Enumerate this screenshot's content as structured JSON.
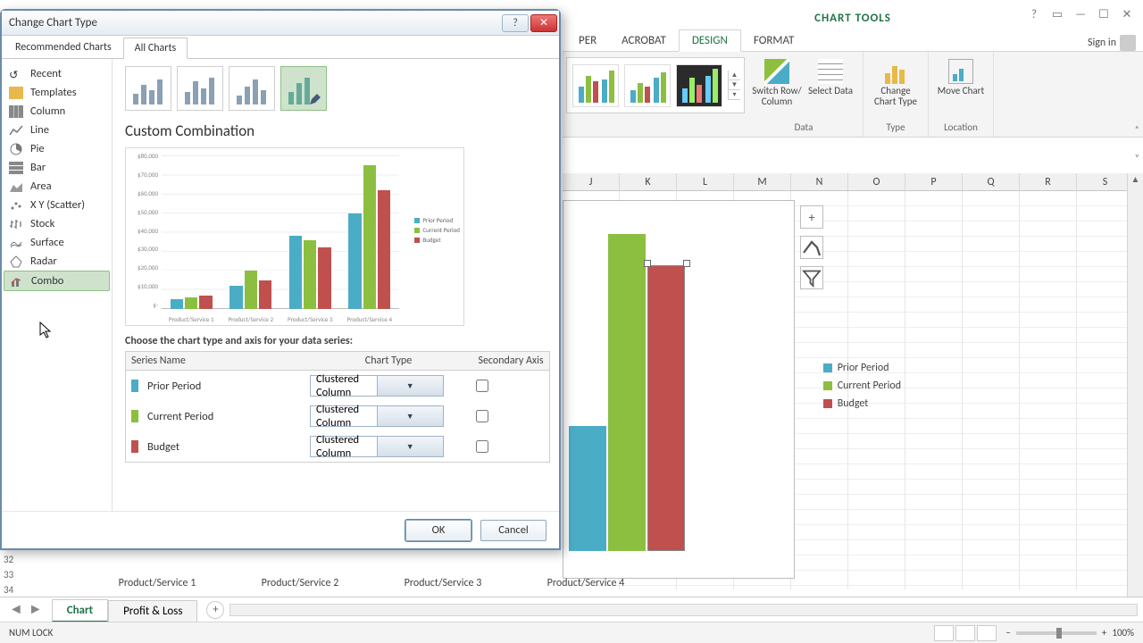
{
  "colors": {
    "prior": "#4bacc6",
    "current": "#8cbf3f",
    "budget": "#c0504d"
  },
  "window": {
    "chart_tools": "CHART TOOLS",
    "tabs": [
      "PER",
      "ACROBAT",
      "DESIGN",
      "FORMAT"
    ],
    "active_tab": "DESIGN",
    "sign_in": "Sign in"
  },
  "ribbon": {
    "groups": {
      "data": {
        "label": "Data",
        "switch": "Switch Row/\nColumn",
        "select": "Select\nData"
      },
      "type": {
        "label": "Type",
        "change": "Change\nChart Type"
      },
      "location": {
        "label": "Location",
        "move": "Move\nChart"
      }
    }
  },
  "columns": [
    "J",
    "K",
    "L",
    "M",
    "N",
    "O",
    "P",
    "Q",
    "R",
    "S"
  ],
  "rows": [
    "32",
    "33",
    "34"
  ],
  "embedded_chart": {
    "legend": [
      "Prior Period",
      "Current Period",
      "Budget"
    ],
    "axis": [
      "Product/Service 1",
      "Product/Service 2",
      "Product/Service 3",
      "Product/Service 4"
    ]
  },
  "sheet_tabs": {
    "active": "Chart",
    "other": "Profit & Loss"
  },
  "status": {
    "numlock": "NUM LOCK",
    "zoom": "100%"
  },
  "dialog": {
    "title": "Change Chart Type",
    "tabs": {
      "recommended": "Recommended Charts",
      "all": "All Charts"
    },
    "categories": [
      "Recent",
      "Templates",
      "Column",
      "Line",
      "Pie",
      "Bar",
      "Area",
      "X Y (Scatter)",
      "Stock",
      "Surface",
      "Radar",
      "Combo"
    ],
    "selected_category": "Combo",
    "heading": "Custom Combination",
    "choose_label": "Choose the chart type and axis for your data series:",
    "table_headers": {
      "name": "Series Name",
      "type": "Chart Type",
      "axis": "Secondary Axis"
    },
    "series": [
      {
        "name": "Prior Period",
        "type": "Clustered Column",
        "secondary": false,
        "color": "#4bacc6"
      },
      {
        "name": "Current Period",
        "type": "Clustered Column",
        "secondary": false,
        "color": "#8cbf3f"
      },
      {
        "name": "Budget",
        "type": "Clustered Column",
        "secondary": false,
        "color": "#c0504d"
      }
    ],
    "buttons": {
      "ok": "OK",
      "cancel": "Cancel"
    }
  },
  "chart_data": {
    "type": "bar",
    "title": "",
    "categories": [
      "Product/Service 1",
      "Product/Service 2",
      "Product/Service 3",
      "Product/Service 4"
    ],
    "series": [
      {
        "name": "Prior Period",
        "values": [
          5000,
          12000,
          38000,
          50000
        ]
      },
      {
        "name": "Current Period",
        "values": [
          6000,
          20000,
          36000,
          75000
        ]
      },
      {
        "name": "Budget",
        "values": [
          7000,
          15000,
          32000,
          62000
        ]
      }
    ],
    "ylabel": "$",
    "ylim": [
      0,
      80000
    ],
    "yticks": [
      "$80,000",
      "$70,000",
      "$60,000",
      "$50,000",
      "$40,000",
      "$30,000",
      "$20,000",
      "$10,000",
      "$-"
    ]
  }
}
